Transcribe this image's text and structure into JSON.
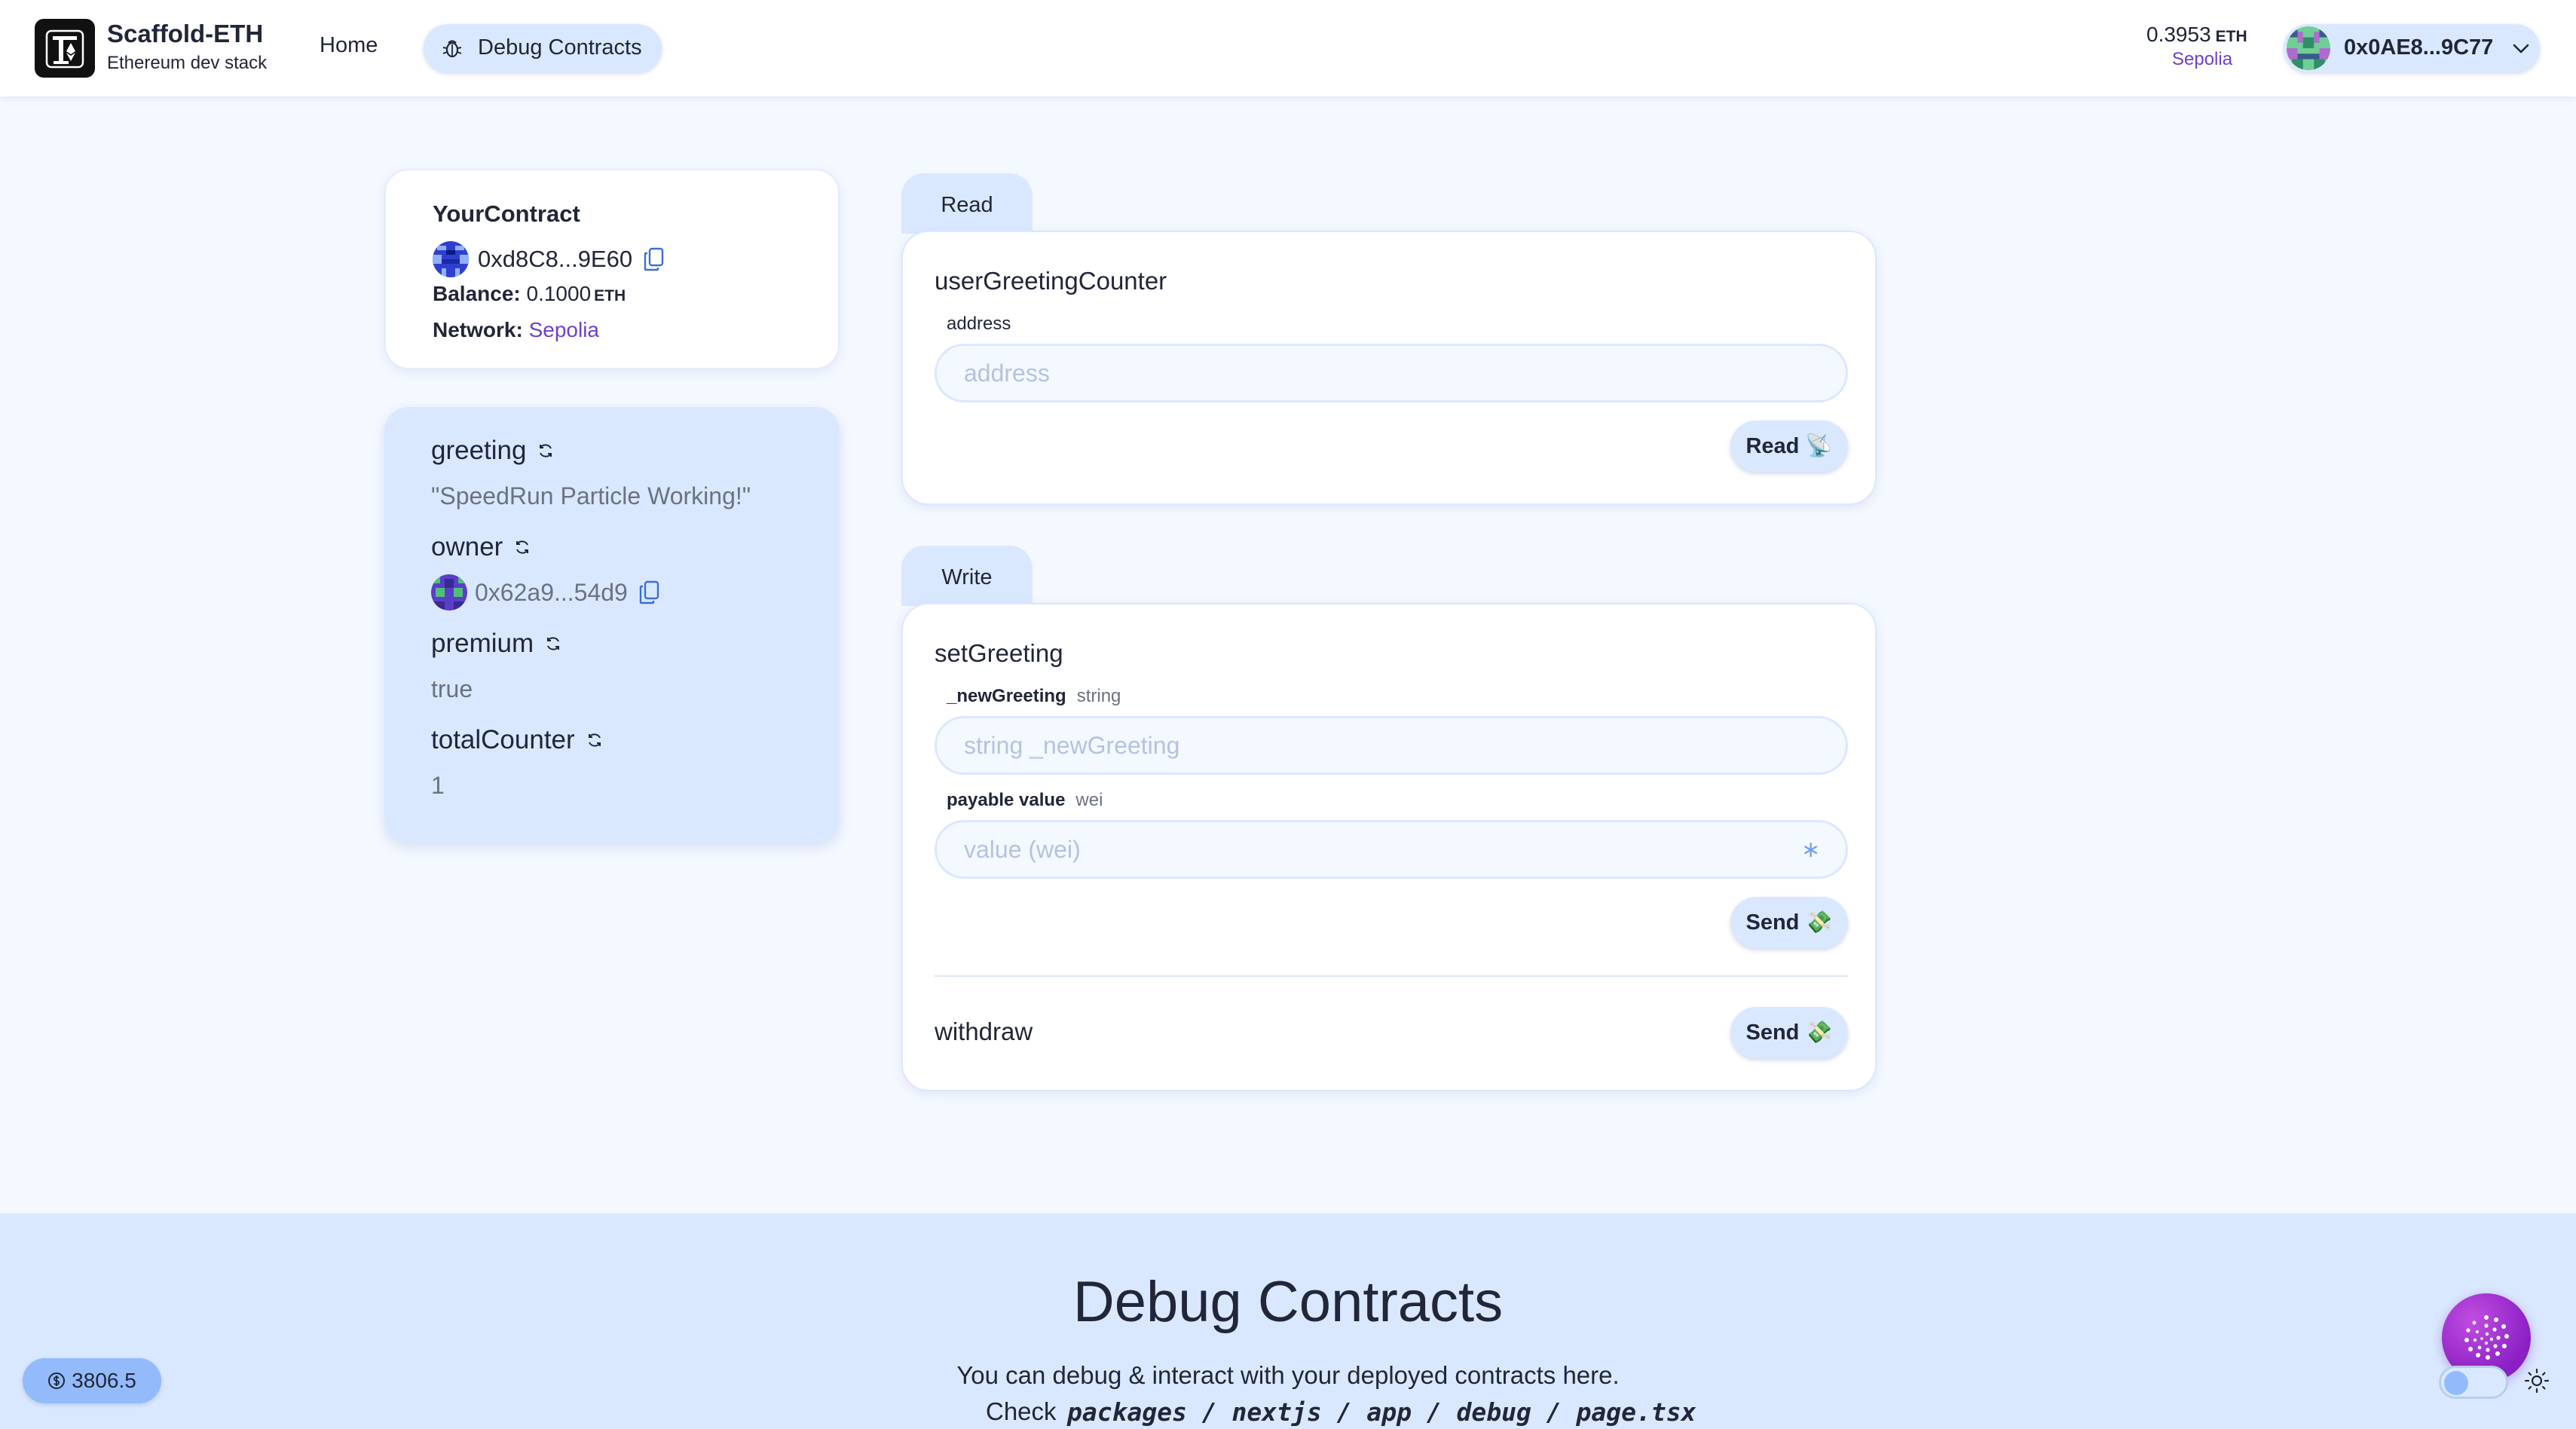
{
  "header": {
    "brand_title": "Scaffold-ETH",
    "brand_subtitle": "Ethereum dev stack",
    "nav": {
      "home": "Home",
      "debug": "Debug Contracts"
    },
    "balance": {
      "amount": "0.3953",
      "unit": "ETH",
      "network": "Sepolia"
    },
    "account": {
      "address": "0x0AE8...9C77"
    }
  },
  "contract": {
    "name": "YourContract",
    "address": "0xd8C8...9E60",
    "balance_label": "Balance:",
    "balance_value": "0.1000",
    "balance_unit": "ETH",
    "network_label": "Network:",
    "network_value": "Sepolia"
  },
  "variables": [
    {
      "name": "greeting",
      "value": "\"SpeedRun Particle Working!\""
    },
    {
      "name": "owner",
      "value": "0x62a9...54d9"
    },
    {
      "name": "premium",
      "value": "true"
    },
    {
      "name": "totalCounter",
      "value": "1"
    }
  ],
  "read": {
    "tab": "Read",
    "function": "userGreetingCounter",
    "param_label": "address",
    "placeholder": "address",
    "button": "Read",
    "button_emoji": "📡"
  },
  "write": {
    "tab": "Write",
    "set_greeting": {
      "function": "setGreeting",
      "param_name": "_newGreeting",
      "param_type": "string",
      "placeholder": "string _newGreeting",
      "payable_label": "payable value",
      "payable_unit": "wei",
      "payable_placeholder": "value (wei)",
      "asterisk": "∗",
      "button": "Send",
      "button_emoji": "💸"
    },
    "withdraw": {
      "function": "withdraw",
      "button": "Send",
      "button_emoji": "💸"
    }
  },
  "footer": {
    "title": "Debug Contracts",
    "description": "You can debug & interact with your deployed contracts here.",
    "check_label": "Check",
    "path": "packages / nextjs / app / debug / page.tsx"
  },
  "price": {
    "value": "3806.5"
  },
  "colors": {
    "accent": "#dae8ff",
    "primary": "#93bbfb",
    "network": "#6e40c9",
    "background": "#f4f8ff",
    "fab": "#9b2bd6"
  }
}
